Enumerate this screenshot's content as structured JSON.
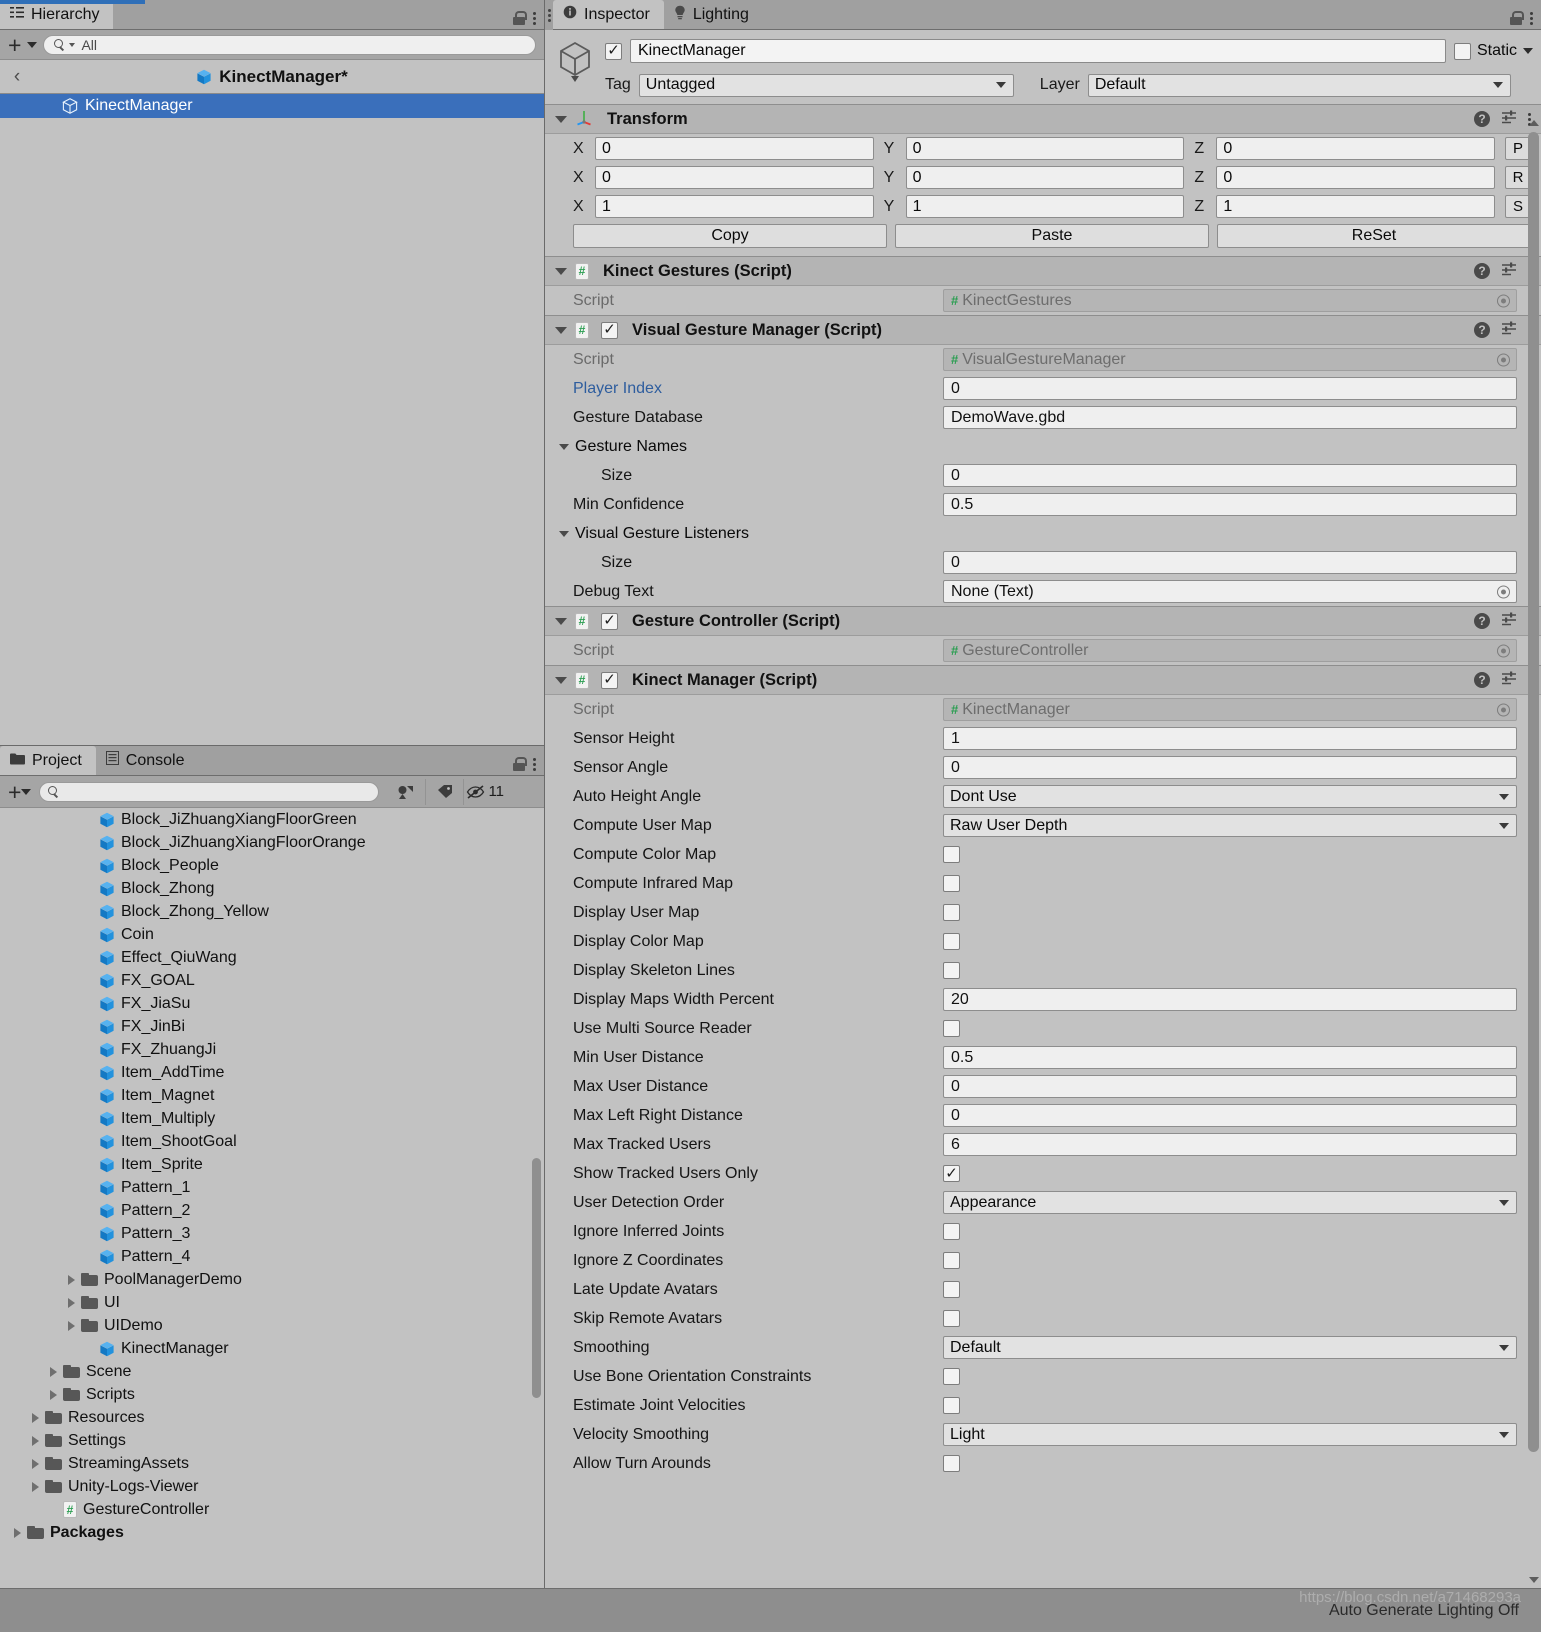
{
  "hierarchy": {
    "tab_label": "Hierarchy",
    "search_placeholder": "All",
    "breadcrumb_title": "KinectManager*",
    "back_glyph": "‹",
    "rows": [
      {
        "label": "KinectManager",
        "selected": true
      }
    ]
  },
  "project": {
    "tabs": [
      {
        "label": "Project",
        "active": true
      },
      {
        "label": "Console",
        "active": false
      }
    ],
    "search_value": "",
    "hidden_count": "11",
    "rows": [
      {
        "label": "Block_JiZhuangXiangFloorGreen",
        "type": "prefab",
        "indent": 3,
        "arrow": false
      },
      {
        "label": "Block_JiZhuangXiangFloorOrange",
        "type": "prefab",
        "indent": 3,
        "arrow": false
      },
      {
        "label": "Block_People",
        "type": "prefab",
        "indent": 3,
        "arrow": false
      },
      {
        "label": "Block_Zhong",
        "type": "prefab",
        "indent": 3,
        "arrow": false
      },
      {
        "label": "Block_Zhong_Yellow",
        "type": "prefab",
        "indent": 3,
        "arrow": false
      },
      {
        "label": "Coin",
        "type": "prefab",
        "indent": 3,
        "arrow": false
      },
      {
        "label": "Effect_QiuWang",
        "type": "prefab",
        "indent": 3,
        "arrow": false
      },
      {
        "label": "FX_GOAL",
        "type": "prefab",
        "indent": 3,
        "arrow": false
      },
      {
        "label": "FX_JiaSu",
        "type": "prefab",
        "indent": 3,
        "arrow": false
      },
      {
        "label": "FX_JinBi",
        "type": "prefab",
        "indent": 3,
        "arrow": false
      },
      {
        "label": "FX_ZhuangJi",
        "type": "prefab",
        "indent": 3,
        "arrow": false
      },
      {
        "label": "Item_AddTime",
        "type": "prefab",
        "indent": 3,
        "arrow": false
      },
      {
        "label": "Item_Magnet",
        "type": "prefab",
        "indent": 3,
        "arrow": false
      },
      {
        "label": "Item_Multiply",
        "type": "prefab",
        "indent": 3,
        "arrow": false
      },
      {
        "label": "Item_ShootGoal",
        "type": "prefab",
        "indent": 3,
        "arrow": false
      },
      {
        "label": "Item_Sprite",
        "type": "prefab",
        "indent": 3,
        "arrow": false
      },
      {
        "label": "Pattern_1",
        "type": "prefab",
        "indent": 3,
        "arrow": false
      },
      {
        "label": "Pattern_2",
        "type": "prefab",
        "indent": 3,
        "arrow": false
      },
      {
        "label": "Pattern_3",
        "type": "prefab",
        "indent": 3,
        "arrow": false
      },
      {
        "label": "Pattern_4",
        "type": "prefab",
        "indent": 3,
        "arrow": false
      },
      {
        "label": "PoolManagerDemo",
        "type": "folder",
        "indent": 2,
        "arrow": true
      },
      {
        "label": "UI",
        "type": "folder",
        "indent": 2,
        "arrow": true
      },
      {
        "label": "UIDemo",
        "type": "folder",
        "indent": 2,
        "arrow": true
      },
      {
        "label": "KinectManager",
        "type": "prefab",
        "indent": 3,
        "arrow": false
      },
      {
        "label": "Scene",
        "type": "folder",
        "indent": 1,
        "arrow": true
      },
      {
        "label": "Scripts",
        "type": "folder",
        "indent": 1,
        "arrow": true
      },
      {
        "label": "Resources",
        "type": "folder",
        "indent": 0,
        "arrow": true
      },
      {
        "label": "Settings",
        "type": "folder",
        "indent": 0,
        "arrow": true
      },
      {
        "label": "StreamingAssets",
        "type": "folder",
        "indent": 0,
        "arrow": true
      },
      {
        "label": "Unity-Logs-Viewer",
        "type": "folder",
        "indent": 0,
        "arrow": true
      },
      {
        "label": "GestureController",
        "type": "script",
        "indent": 1,
        "arrow": false
      },
      {
        "label": "Packages",
        "type": "folder",
        "indent": -1,
        "arrow": true,
        "bold": true
      }
    ]
  },
  "inspector": {
    "tabs": [
      {
        "label": "Inspector",
        "active": true,
        "icon": "info-icon"
      },
      {
        "label": "Lighting",
        "active": false,
        "icon": "lightbulb-icon"
      }
    ],
    "game_object": {
      "enabled": true,
      "name": "KinectManager",
      "static_label": "Static",
      "static_checked": false,
      "tag_label": "Tag",
      "tag_value": "Untagged",
      "layer_label": "Layer",
      "layer_value": "Default"
    },
    "components": [
      {
        "id": "transform",
        "title": "Transform",
        "icon": "transform-icon",
        "has_checkbox": false,
        "kind": "transform",
        "rows": [
          {
            "axis_labels": [
              "X",
              "Y",
              "Z"
            ],
            "values": [
              "0",
              "0",
              "0"
            ],
            "button": "P"
          },
          {
            "axis_labels": [
              "X",
              "Y",
              "Z"
            ],
            "values": [
              "0",
              "0",
              "0"
            ],
            "button": "R"
          },
          {
            "axis_labels": [
              "X",
              "Y",
              "Z"
            ],
            "values": [
              "1",
              "1",
              "1"
            ],
            "button": "S"
          }
        ],
        "buttons": [
          "Copy",
          "Paste",
          "ReSet"
        ]
      },
      {
        "id": "kinect-gestures",
        "title": "Kinect Gestures (Script)",
        "icon": "script-icon",
        "has_checkbox": false,
        "kind": "props",
        "props": [
          {
            "label": "Script",
            "type": "object",
            "value": "KinectGestures",
            "dim": true
          }
        ]
      },
      {
        "id": "visual-gesture-manager",
        "title": "Visual Gesture Manager (Script)",
        "icon": "script-icon",
        "has_checkbox": true,
        "checked": true,
        "kind": "props",
        "props": [
          {
            "label": "Script",
            "type": "object",
            "value": "VisualGestureManager",
            "dim": true
          },
          {
            "label": "Player Index",
            "type": "text",
            "value": "0",
            "blue": true
          },
          {
            "label": "Gesture Database",
            "type": "text",
            "value": "DemoWave.gbd"
          },
          {
            "label": "Gesture Names",
            "type": "foldout"
          },
          {
            "label": "Size",
            "type": "text",
            "value": "0",
            "indent": true
          },
          {
            "label": "Min Confidence",
            "type": "text",
            "value": "0.5"
          },
          {
            "label": "Visual Gesture Listeners",
            "type": "foldout"
          },
          {
            "label": "Size",
            "type": "text",
            "value": "0",
            "indent": true
          },
          {
            "label": "Debug Text",
            "type": "object-light",
            "value": "None (Text)"
          }
        ]
      },
      {
        "id": "gesture-controller",
        "title": "Gesture Controller (Script)",
        "icon": "script-icon",
        "has_checkbox": true,
        "checked": true,
        "kind": "props",
        "props": [
          {
            "label": "Script",
            "type": "object",
            "value": "GestureController",
            "dim": true
          }
        ]
      },
      {
        "id": "kinect-manager",
        "title": "Kinect Manager (Script)",
        "icon": "script-icon",
        "has_checkbox": true,
        "checked": true,
        "kind": "props",
        "props": [
          {
            "label": "Script",
            "type": "object",
            "value": "KinectManager",
            "dim": true
          },
          {
            "label": "Sensor Height",
            "type": "text",
            "value": "1"
          },
          {
            "label": "Sensor Angle",
            "type": "text",
            "value": "0"
          },
          {
            "label": "Auto Height Angle",
            "type": "dropdown",
            "value": "Dont Use"
          },
          {
            "label": "Compute User Map",
            "type": "dropdown",
            "value": "Raw User Depth"
          },
          {
            "label": "Compute Color Map",
            "type": "checkbox",
            "value": false
          },
          {
            "label": "Compute Infrared Map",
            "type": "checkbox",
            "value": false
          },
          {
            "label": "Display User Map",
            "type": "checkbox",
            "value": false
          },
          {
            "label": "Display Color Map",
            "type": "checkbox",
            "value": false
          },
          {
            "label": "Display Skeleton Lines",
            "type": "checkbox",
            "value": false
          },
          {
            "label": "Display Maps Width Percent",
            "type": "text",
            "value": "20"
          },
          {
            "label": "Use Multi Source Reader",
            "type": "checkbox",
            "value": false
          },
          {
            "label": "Min User Distance",
            "type": "text",
            "value": "0.5"
          },
          {
            "label": "Max User Distance",
            "type": "text",
            "value": "0"
          },
          {
            "label": "Max Left Right Distance",
            "type": "text",
            "value": "0"
          },
          {
            "label": "Max Tracked Users",
            "type": "text",
            "value": "6"
          },
          {
            "label": "Show Tracked Users Only",
            "type": "checkbox",
            "value": true
          },
          {
            "label": "User Detection Order",
            "type": "dropdown",
            "value": "Appearance"
          },
          {
            "label": "Ignore Inferred Joints",
            "type": "checkbox",
            "value": false
          },
          {
            "label": "Ignore Z Coordinates",
            "type": "checkbox",
            "value": false
          },
          {
            "label": "Late Update Avatars",
            "type": "checkbox",
            "value": false
          },
          {
            "label": "Skip Remote Avatars",
            "type": "checkbox",
            "value": false
          },
          {
            "label": "Smoothing",
            "type": "dropdown",
            "value": "Default"
          },
          {
            "label": "Use Bone Orientation Constraints",
            "type": "checkbox",
            "value": false
          },
          {
            "label": "Estimate Joint Velocities",
            "type": "checkbox",
            "value": false
          },
          {
            "label": "Velocity Smoothing",
            "type": "dropdown",
            "value": "Light"
          },
          {
            "label": "Allow Turn Arounds",
            "type": "checkbox",
            "value": false
          }
        ]
      }
    ]
  },
  "status_bar": {
    "text": "Auto Generate Lighting Off"
  },
  "watermark": {
    "text": "https://blog.csdn.net/a71468293a"
  },
  "colors": {
    "selection_blue": "#3a6fbb",
    "prefab_blue": "#2196e3",
    "script_green": "#2c9e52",
    "panel_bg": "#c2c2c2",
    "chrome_bg": "#a5a5a5",
    "link_blue": "#2e5d9e"
  }
}
